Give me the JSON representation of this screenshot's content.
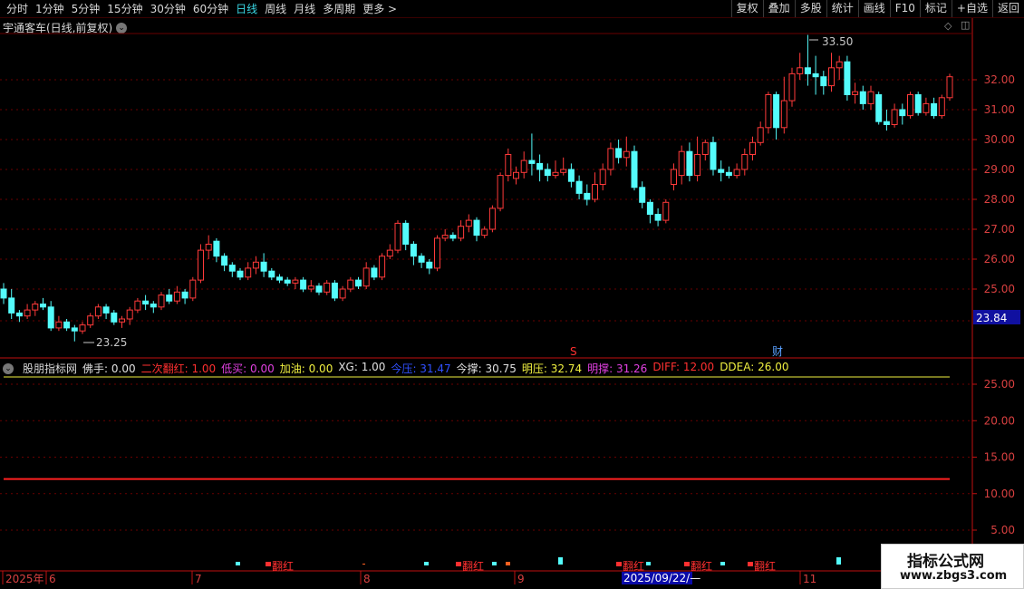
{
  "toolbar": {
    "left": [
      "分时",
      "1分钟",
      "5分钟",
      "15分钟",
      "30分钟",
      "60分钟",
      "日线",
      "周线",
      "月线",
      "多周期",
      "更多 >"
    ],
    "active_index": 6,
    "right": [
      "复权",
      "叠加",
      "多股",
      "统计",
      "画线",
      "F10",
      "标记",
      "+自选",
      "返回"
    ]
  },
  "stock_title": "宇通客车(日线,前复权)",
  "price_axis": [
    "32.00",
    "31.00",
    "30.00",
    "29.00",
    "28.00",
    "27.00",
    "26.00",
    "25.00"
  ],
  "current_price": "23.84",
  "high_label": "33.50",
  "low_label": "23.25",
  "marker_s": "S",
  "marker_cai": "财",
  "indicator": {
    "name": "股朋指标网",
    "items": [
      {
        "label": "佛手: 0.00",
        "color": "#e0e0e0"
      },
      {
        "label": "二次翻红: 1.00",
        "color": "#ff3030"
      },
      {
        "label": "低买: 0.00",
        "color": "#e040e0"
      },
      {
        "label": "加油: 0.00",
        "color": "#f0f040"
      },
      {
        "label": "XG: 1.00",
        "color": "#e0e0e0"
      },
      {
        "label": "今压: 31.47",
        "color": "#3050ff"
      },
      {
        "label": "今撑: 30.75",
        "color": "#e0e0e0"
      },
      {
        "label": "明压: 32.74",
        "color": "#f0f040"
      },
      {
        "label": "明撑: 31.26",
        "color": "#e040e0"
      },
      {
        "label": "DIFF: 12.00",
        "color": "#ff3030"
      },
      {
        "label": "DDEA: 26.00",
        "color": "#f0f040"
      }
    ]
  },
  "indicator_axis": [
    "25.00",
    "20.00",
    "15.00",
    "10.00",
    "5.00"
  ],
  "fan_hong_label": "翻红",
  "dates": {
    "year": "2025年",
    "m6": "6",
    "m7": "7",
    "m8": "8",
    "m9": "9",
    "m11": "11",
    "cursor": "2025/09/22/—"
  },
  "watermark": {
    "title": "指标公式网",
    "url": "www.zbgs3.com"
  },
  "colors": {
    "up": "#ff3a3a",
    "down": "#54fcfc",
    "grid": "#6a0000",
    "axis": "#c01010"
  }
}
